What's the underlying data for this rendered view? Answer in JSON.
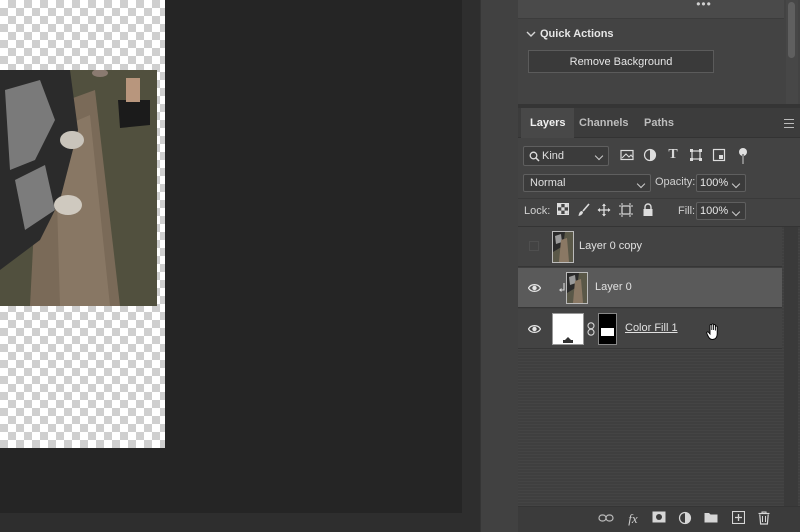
{
  "properties_panel": {
    "more_icon": "ellipsis-icon",
    "quick_actions_label": "Quick Actions",
    "remove_background_label": "Remove Background"
  },
  "layers_panel": {
    "tabs": [
      {
        "label": "Layers",
        "active": true
      },
      {
        "label": "Channels",
        "active": false
      },
      {
        "label": "Paths",
        "active": false
      }
    ],
    "filter_kind": "Kind",
    "blend_mode": "Normal",
    "opacity_label": "Opacity:",
    "opacity_value": "100%",
    "lock_label": "Lock:",
    "fill_label": "Fill:",
    "fill_value": "100%",
    "layers": [
      {
        "name": "Layer 0 copy",
        "visible": false,
        "selected": false,
        "clipped": false
      },
      {
        "name": "Layer 0",
        "visible": true,
        "selected": true,
        "clipped": true
      },
      {
        "name": "Color Fill 1",
        "visible": true,
        "selected": false,
        "type": "fill"
      }
    ]
  },
  "colors": {
    "panel_bg": "#434343",
    "canvas_bg": "#252525",
    "selected_row": "#5a5a5a"
  }
}
